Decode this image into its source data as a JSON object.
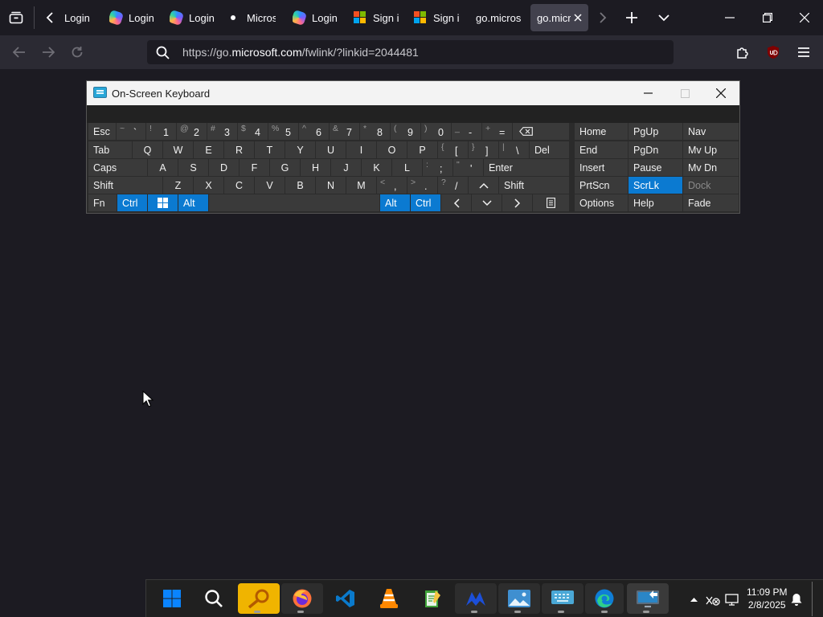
{
  "browser": {
    "tabs": [
      {
        "title": "Login",
        "favicon": "none"
      },
      {
        "title": "Login",
        "favicon": "copilot-icon"
      },
      {
        "title": "Login",
        "favicon": "copilot-icon"
      },
      {
        "title": "Micros",
        "favicon": "loading-dot"
      },
      {
        "title": "Login",
        "favicon": "copilot-icon"
      },
      {
        "title": "Sign in",
        "favicon": "microsoft-icon"
      },
      {
        "title": "Sign in",
        "favicon": "microsoft-icon"
      },
      {
        "title": "go.microsoft",
        "favicon": "none"
      },
      {
        "title": "go.micro",
        "favicon": "none",
        "active": true
      }
    ],
    "url": {
      "scheme": "https://go.",
      "host": "microsoft.com",
      "path": "/fwlink/?linkid=2044481"
    },
    "colors": {
      "accent": "#0b7ad1",
      "toolbar": "#2b2a33",
      "background": "#1c1b22"
    }
  },
  "osk": {
    "title": "On-Screen Keyboard",
    "rows": [
      [
        {
          "label": "Esc"
        },
        {
          "shift": "~",
          "main": "`"
        },
        {
          "shift": "!",
          "main": "1"
        },
        {
          "shift": "@",
          "main": "2"
        },
        {
          "shift": "#",
          "main": "3"
        },
        {
          "shift": "$",
          "main": "4"
        },
        {
          "shift": "%",
          "main": "5"
        },
        {
          "shift": "^",
          "main": "6"
        },
        {
          "shift": "&",
          "main": "7"
        },
        {
          "shift": "*",
          "main": "8"
        },
        {
          "shift": "(",
          "main": "9"
        },
        {
          "shift": ")",
          "main": "0"
        },
        {
          "shift": "_",
          "main": "-"
        },
        {
          "shift": "+",
          "main": "="
        },
        {
          "icon": "backspace-icon"
        }
      ],
      [
        {
          "label": "Tab"
        },
        {
          "label": "Q"
        },
        {
          "label": "W"
        },
        {
          "label": "E"
        },
        {
          "label": "R"
        },
        {
          "label": "T"
        },
        {
          "label": "Y"
        },
        {
          "label": "U"
        },
        {
          "label": "I"
        },
        {
          "label": "O"
        },
        {
          "label": "P"
        },
        {
          "shift": "{",
          "main": "["
        },
        {
          "shift": "}",
          "main": "]"
        },
        {
          "shift": "|",
          "main": "\\"
        },
        {
          "label": "Del"
        }
      ],
      [
        {
          "label": "Caps"
        },
        {
          "label": "A"
        },
        {
          "label": "S"
        },
        {
          "label": "D"
        },
        {
          "label": "F"
        },
        {
          "label": "G"
        },
        {
          "label": "H"
        },
        {
          "label": "J"
        },
        {
          "label": "K"
        },
        {
          "label": "L"
        },
        {
          "shift": ":",
          "main": ";"
        },
        {
          "shift": "\"",
          "main": "'"
        },
        {
          "label": "Enter"
        }
      ],
      [
        {
          "label": "Shift"
        },
        {
          "label": "Z"
        },
        {
          "label": "X"
        },
        {
          "label": "C"
        },
        {
          "label": "V"
        },
        {
          "label": "B"
        },
        {
          "label": "N"
        },
        {
          "label": "M"
        },
        {
          "shift": "<",
          "main": ","
        },
        {
          "shift": ">",
          "main": "."
        },
        {
          "shift": "?",
          "main": "/"
        },
        {
          "icon": "arrow-up-icon"
        },
        {
          "label": "Shift"
        }
      ],
      [
        {
          "label": "Fn"
        },
        {
          "label": "Ctrl",
          "highlight": true
        },
        {
          "icon": "windows-icon",
          "highlight": true
        },
        {
          "label": "Alt",
          "highlight": true
        },
        {
          "label": ""
        },
        {
          "label": "Alt",
          "highlight": true
        },
        {
          "label": "Ctrl",
          "highlight": true
        },
        {
          "icon": "arrow-left-icon"
        },
        {
          "icon": "arrow-down-icon"
        },
        {
          "icon": "arrow-right-icon"
        },
        {
          "icon": "menu-key-icon"
        }
      ]
    ],
    "nav_keys": [
      [
        "Home",
        "PgUp",
        "Nav"
      ],
      [
        "End",
        "PgDn",
        "Mv Up"
      ],
      [
        "Insert",
        "Pause",
        "Mv Dn"
      ],
      [
        "PrtScn",
        "ScrLk",
        "Dock"
      ],
      [
        "Options",
        "Help",
        "Fade"
      ]
    ],
    "nav_highlight": "ScrLk",
    "nav_disabled": "Dock"
  },
  "taskbar": {
    "apps": [
      {
        "name": "start-button",
        "icon": "windows-logo-icon"
      },
      {
        "name": "search-button",
        "icon": "search-icon"
      },
      {
        "name": "app-key-tool",
        "icon": "magnifier-tool-icon",
        "running": true
      },
      {
        "name": "app-firefox",
        "icon": "firefox-icon",
        "running": true
      },
      {
        "name": "app-vscode",
        "icon": "vscode-icon"
      },
      {
        "name": "app-vlc",
        "icon": "vlc-icon"
      },
      {
        "name": "app-notepad",
        "icon": "notepad-icon"
      },
      {
        "name": "app-copilot",
        "icon": "copilot-icon",
        "running": true
      },
      {
        "name": "app-photos",
        "icon": "photos-icon",
        "running": true
      },
      {
        "name": "app-osk",
        "icon": "keyboard-icon",
        "running": true
      },
      {
        "name": "app-edge",
        "icon": "edge-icon",
        "running": true
      },
      {
        "name": "app-remote-desktop",
        "icon": "remote-desktop-icon",
        "running": true
      }
    ],
    "clock": {
      "time": "11:09 PM",
      "date": "2/8/2025"
    }
  }
}
